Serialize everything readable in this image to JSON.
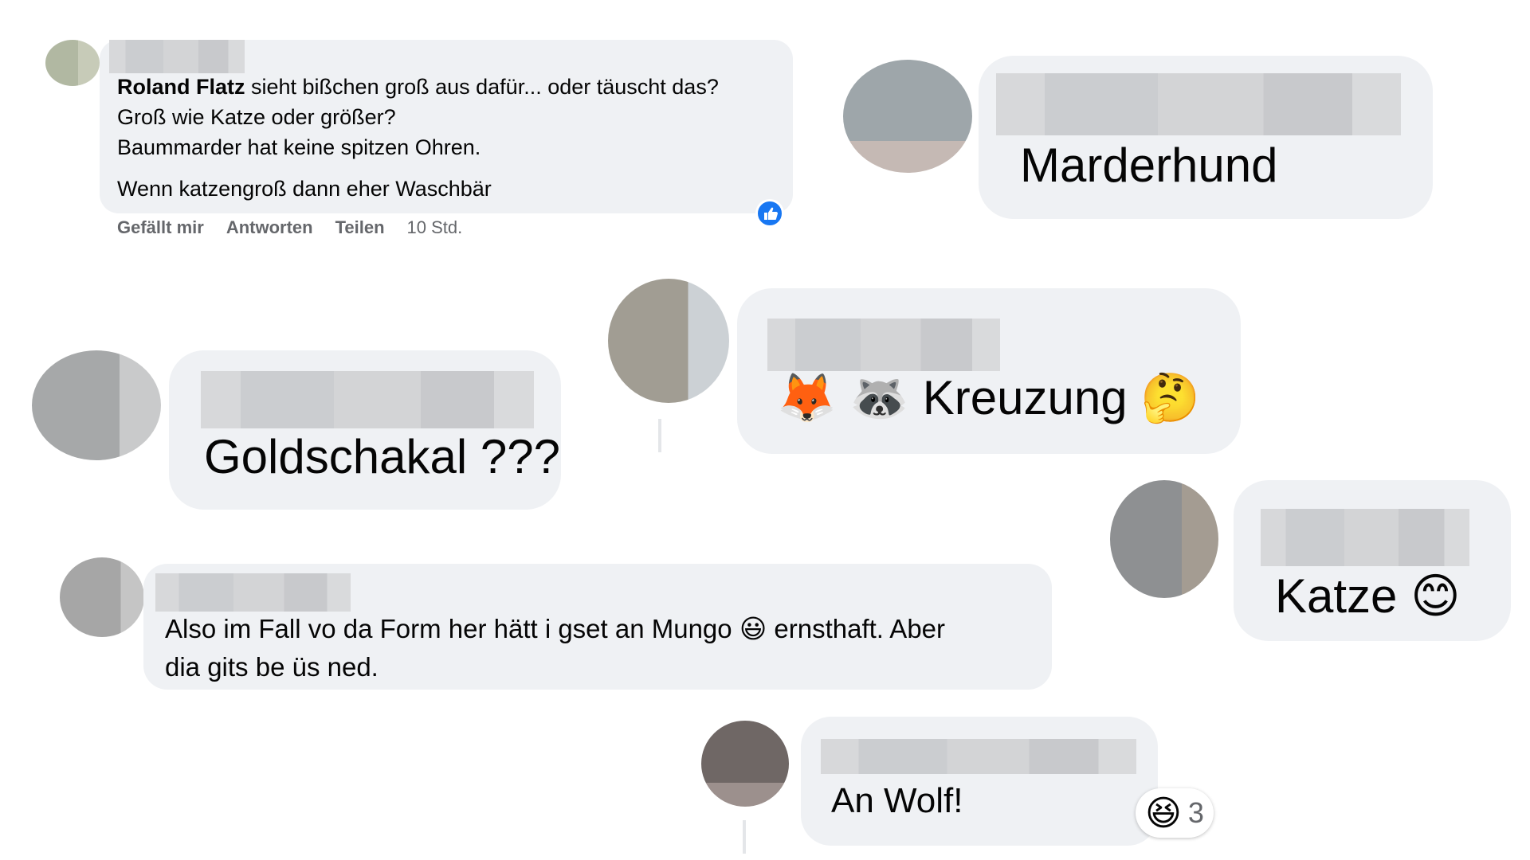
{
  "comment1": {
    "author": "Roland Flatz",
    "line1_rest": " sieht bißchen groß aus dafür... oder täuscht das?",
    "line2": "Groß wie Katze oder größer?",
    "line3": "Baummarder hat keine spitzen Ohren.",
    "line4": "Wenn katzengroß dann eher Waschbär",
    "actions": {
      "like": "Gefällt mir",
      "reply": "Antworten",
      "share": "Teilen",
      "time": "10 Std."
    },
    "reaction_icon": "thumbs-up-icon"
  },
  "comment_marderhund": {
    "text": "Marderhund"
  },
  "comment_kreuzung": {
    "emoji1": "🦊",
    "emoji2": "🦝",
    "text": "Kreuzung",
    "emoji3": "🤔"
  },
  "comment_goldschakal": {
    "text": "Goldschakal ???"
  },
  "comment_katze": {
    "text": "Katze",
    "emoji": "😊"
  },
  "comment_mungo": {
    "line1_a": "Also im Fall vo da Form her hätt i gset an Mungo ",
    "emoji": "😃",
    "line1_b": " ernsthaft. Aber",
    "line2": "dia gits be üs ned."
  },
  "comment_wolf": {
    "text": "An Wolf!",
    "reaction_emoji": "😆",
    "reaction_count": "3"
  },
  "colors": {
    "bubble": "#eff1f4",
    "like_blue": "#1877f2",
    "meta_gray": "#65676b"
  }
}
